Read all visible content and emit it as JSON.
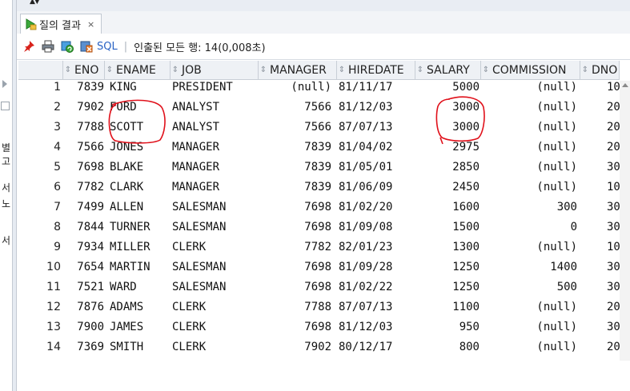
{
  "left_panel": {
    "fragments": [
      "별고",
      "서",
      "노",
      "서"
    ]
  },
  "tab": {
    "label": "질의 결과",
    "close": "×"
  },
  "toolbar": {
    "sql_label": "SQL",
    "separator": "|",
    "status": "인출된 모든 행: 14(0,008초)"
  },
  "grid": {
    "columns": [
      "ENO",
      "ENAME",
      "JOB",
      "MANAGER",
      "HIREDATE",
      "SALARY",
      "COMMISSION",
      "DNO"
    ],
    "rows": [
      {
        "n": "1",
        "eno": "7839",
        "ename": "KING",
        "job": "PRESIDENT",
        "mgr": "(null)",
        "hire": "81/11/17",
        "sal": "5000",
        "comm": "(null)",
        "dno": "10"
      },
      {
        "n": "2",
        "eno": "7902",
        "ename": "FORD",
        "job": "ANALYST",
        "mgr": "7566",
        "hire": "81/12/03",
        "sal": "3000",
        "comm": "(null)",
        "dno": "20"
      },
      {
        "n": "3",
        "eno": "7788",
        "ename": "SCOTT",
        "job": "ANALYST",
        "mgr": "7566",
        "hire": "87/07/13",
        "sal": "3000",
        "comm": "(null)",
        "dno": "20"
      },
      {
        "n": "4",
        "eno": "7566",
        "ename": "JONES",
        "job": "MANAGER",
        "mgr": "7839",
        "hire": "81/04/02",
        "sal": "2975",
        "comm": "(null)",
        "dno": "20"
      },
      {
        "n": "5",
        "eno": "7698",
        "ename": "BLAKE",
        "job": "MANAGER",
        "mgr": "7839",
        "hire": "81/05/01",
        "sal": "2850",
        "comm": "(null)",
        "dno": "30"
      },
      {
        "n": "6",
        "eno": "7782",
        "ename": "CLARK",
        "job": "MANAGER",
        "mgr": "7839",
        "hire": "81/06/09",
        "sal": "2450",
        "comm": "(null)",
        "dno": "10"
      },
      {
        "n": "7",
        "eno": "7499",
        "ename": "ALLEN",
        "job": "SALESMAN",
        "mgr": "7698",
        "hire": "81/02/20",
        "sal": "1600",
        "comm": "300",
        "dno": "30"
      },
      {
        "n": "8",
        "eno": "7844",
        "ename": "TURNER",
        "job": "SALESMAN",
        "mgr": "7698",
        "hire": "81/09/08",
        "sal": "1500",
        "comm": "0",
        "dno": "30"
      },
      {
        "n": "9",
        "eno": "7934",
        "ename": "MILLER",
        "job": "CLERK",
        "mgr": "7782",
        "hire": "82/01/23",
        "sal": "1300",
        "comm": "(null)",
        "dno": "10"
      },
      {
        "n": "10",
        "eno": "7654",
        "ename": "MARTIN",
        "job": "SALESMAN",
        "mgr": "7698",
        "hire": "81/09/28",
        "sal": "1250",
        "comm": "1400",
        "dno": "30"
      },
      {
        "n": "11",
        "eno": "7521",
        "ename": "WARD",
        "job": "SALESMAN",
        "mgr": "7698",
        "hire": "81/02/22",
        "sal": "1250",
        "comm": "500",
        "dno": "30"
      },
      {
        "n": "12",
        "eno": "7876",
        "ename": "ADAMS",
        "job": "CLERK",
        "mgr": "7788",
        "hire": "87/07/13",
        "sal": "1100",
        "comm": "(null)",
        "dno": "20"
      },
      {
        "n": "13",
        "eno": "7900",
        "ename": "JAMES",
        "job": "CLERK",
        "mgr": "7698",
        "hire": "81/12/03",
        "sal": "950",
        "comm": "(null)",
        "dno": "30"
      },
      {
        "n": "14",
        "eno": "7369",
        "ename": "SMITH",
        "job": "CLERK",
        "mgr": "7902",
        "hire": "80/12/17",
        "sal": "800",
        "comm": "(null)",
        "dno": "20"
      }
    ]
  },
  "colors": {
    "annotation": "#e0101a",
    "header_bg": "#eef1f5",
    "link": "#2a63c4"
  }
}
